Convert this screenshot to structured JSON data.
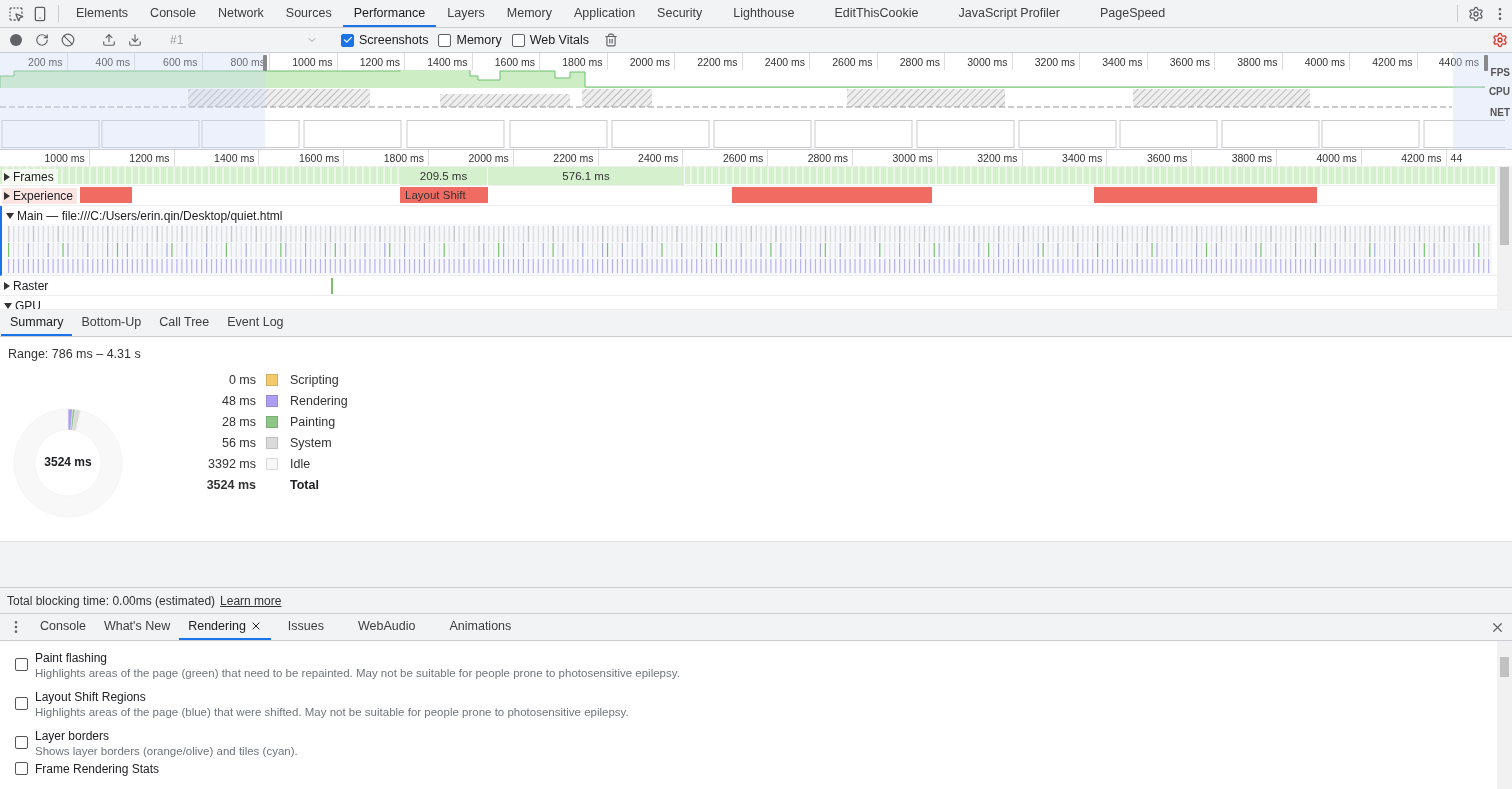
{
  "tabs": [
    {
      "label": "Elements",
      "selected": false
    },
    {
      "label": "Console",
      "selected": false
    },
    {
      "label": "Network",
      "selected": false
    },
    {
      "label": "Sources",
      "selected": false
    },
    {
      "label": "Performance",
      "selected": true
    },
    {
      "label": "Layers",
      "selected": false
    },
    {
      "label": "Memory",
      "selected": false
    },
    {
      "label": "Application",
      "selected": false
    },
    {
      "label": "Security",
      "selected": false
    },
    {
      "label": "Lighthouse",
      "selected": false
    },
    {
      "label": "EditThisCookie",
      "selected": false
    },
    {
      "label": "JavaScript Profiler",
      "selected": false
    },
    {
      "label": "PageSpeed",
      "selected": false
    }
  ],
  "toolbar": {
    "recording": {
      "placeholder": "#1",
      "disabled": true
    },
    "checkboxes": [
      {
        "label": "Screenshots",
        "checked": true
      },
      {
        "label": "Memory",
        "checked": false
      },
      {
        "label": "Web Vitals",
        "checked": false
      }
    ]
  },
  "overview": {
    "ticks": [
      "200 ms",
      "400 ms",
      "600 ms",
      "800 ms",
      "1000 ms",
      "1200 ms",
      "1400 ms",
      "1600 ms",
      "1800 ms",
      "2000 ms",
      "2200 ms",
      "2400 ms",
      "2600 ms",
      "2800 ms",
      "3000 ms",
      "3200 ms",
      "3400 ms",
      "3600 ms",
      "3800 ms",
      "4000 ms",
      "4200 ms",
      "4400 ms"
    ],
    "track_labels": [
      "FPS",
      "CPU",
      "NET"
    ]
  },
  "timeline": {
    "ticks": [
      "1000 ms",
      "1200 ms",
      "1400 ms",
      "1600 ms",
      "1800 ms",
      "2000 ms",
      "2200 ms",
      "2400 ms",
      "2600 ms",
      "2800 ms",
      "3000 ms",
      "3200 ms",
      "3400 ms",
      "3600 ms",
      "3800 ms",
      "4000 ms",
      "4200 ms",
      "44"
    ],
    "tracks": [
      {
        "kind": "frames",
        "label": "Frames",
        "expanded": false,
        "frames": [
          "209.5 ms",
          "576.1 ms"
        ]
      },
      {
        "kind": "experience",
        "label": "Experience",
        "expanded": false,
        "event": "Layout Shift"
      },
      {
        "kind": "main",
        "label": "Main — file:///C:/Users/erin.qin/Desktop/quiet.html",
        "expanded": true
      },
      {
        "kind": "raster",
        "label": "Raster",
        "expanded": false
      },
      {
        "kind": "gpu",
        "label": "GPU",
        "expanded": true
      }
    ]
  },
  "details": {
    "tabs": [
      {
        "label": "Summary",
        "selected": true
      },
      {
        "label": "Bottom-Up",
        "selected": false
      },
      {
        "label": "Call Tree",
        "selected": false
      },
      {
        "label": "Event Log",
        "selected": false
      }
    ],
    "range": "Range: 786 ms – 4.31 s",
    "donut_label": "3524 ms",
    "chart_data": {
      "type": "donut",
      "categories": [
        "Scripting",
        "Rendering",
        "Painting",
        "System",
        "Idle"
      ],
      "values": [
        0,
        1.362,
        0.795,
        1.589,
        96.254
      ]
    },
    "legend": [
      {
        "value": "0 ms",
        "color": "#f2c96d"
      },
      {
        "value": "48 ms",
        "color": "#af9df2"
      },
      {
        "value": "28 ms",
        "color": "#8cc787"
      },
      {
        "value": "56 ms",
        "color": "#dadada"
      },
      {
        "value": "3392 ms",
        "color": "#f8f8f8"
      }
    ],
    "total": {
      "value": "3524 ms",
      "label": "Total"
    },
    "footer": {
      "text": "Total blocking time: 0.00ms (estimated)",
      "link": "Learn more"
    }
  },
  "drawer": {
    "tabs": [
      {
        "label": "Console",
        "selected": false,
        "closable": false
      },
      {
        "label": "What's New",
        "selected": false,
        "closable": false
      },
      {
        "label": "Rendering",
        "selected": true,
        "closable": true
      },
      {
        "label": "Issues",
        "selected": false,
        "closable": false
      },
      {
        "label": "WebAudio",
        "selected": false,
        "closable": false
      },
      {
        "label": "Animations",
        "selected": false,
        "closable": false
      }
    ],
    "options": [
      {
        "title": "Paint flashing",
        "description": "Highlights areas of the page (green) that need to be repainted. May not be suitable for people prone to photosensitive epilepsy.",
        "checked": false
      },
      {
        "title": "Layout Shift Regions",
        "description": "Highlights areas of the page (blue) that were shifted. May not be suitable for people prone to photosensitive epilepsy.",
        "checked": false
      },
      {
        "title": "Layer borders",
        "description": "Shows layer borders (orange/olive) and tiles (cyan).",
        "checked": false
      },
      {
        "title": "Frame Rendering Stats",
        "checked": false
      }
    ]
  }
}
